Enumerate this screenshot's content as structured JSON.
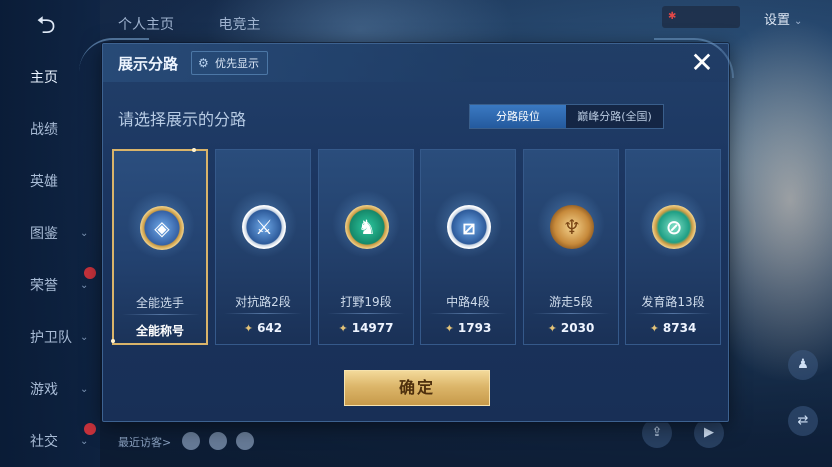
{
  "nav": {
    "back_icon": "back-arrow-icon",
    "items": [
      {
        "label": "主页",
        "active": true
      },
      {
        "label": "战绩"
      },
      {
        "label": "英雄"
      },
      {
        "label": "图鉴"
      },
      {
        "label": "荣誉"
      },
      {
        "label": "护卫队"
      },
      {
        "label": "游戏"
      },
      {
        "label": "社交"
      }
    ]
  },
  "top": {
    "tabs": [
      "个人主页",
      "电竞主"
    ],
    "badge_icon": "✱",
    "settings_label": "设置"
  },
  "bottom": {
    "visitors_label": "最近访客>"
  },
  "modal": {
    "title": "展示分路",
    "priority_label": "优先显示",
    "subtitle": "请选择展示的分路",
    "toggle": {
      "option1": "分路段位",
      "option2": "巅峰分路(全国)",
      "selected": "option1"
    },
    "cards": [
      {
        "label": "全能选手",
        "score_text": "全能称号",
        "show_icon": false,
        "emblem": "all-round-emblem-icon",
        "selected": true
      },
      {
        "label": "对抗路2段",
        "score": "642",
        "show_icon": true,
        "emblem": "clash-lane-emblem-icon"
      },
      {
        "label": "打野19段",
        "score": "14977",
        "show_icon": true,
        "emblem": "jungle-emblem-icon"
      },
      {
        "label": "中路4段",
        "score": "1793",
        "show_icon": true,
        "emblem": "mid-lane-emblem-icon"
      },
      {
        "label": "游走5段",
        "score": "2030",
        "show_icon": true,
        "emblem": "roam-emblem-icon"
      },
      {
        "label": "发育路13段",
        "score": "8734",
        "show_icon": true,
        "emblem": "farm-lane-emblem-icon"
      }
    ],
    "confirm_label": "确定"
  },
  "colors": {
    "accent_gold": "#d9b46a",
    "modal_bg": "#1b3560",
    "toggle_active": "#3a79c2"
  }
}
